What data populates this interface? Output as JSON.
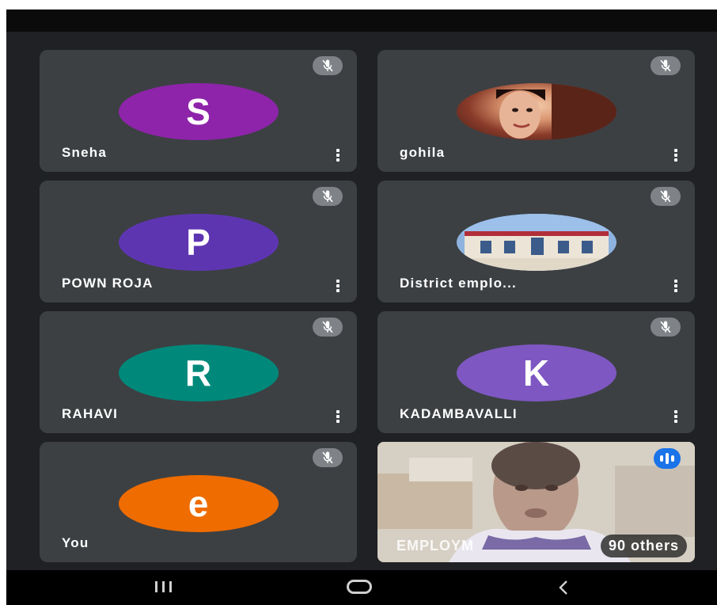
{
  "participants": [
    {
      "name": "Sneha",
      "initial": "S",
      "color": "#8e24aa",
      "photo": false
    },
    {
      "name": "gohila",
      "initial": "",
      "color": "#b0684a",
      "photo": true
    },
    {
      "name": "POWN ROJA",
      "initial": "P",
      "color": "#5e35b1",
      "photo": false
    },
    {
      "name": "District emplo...",
      "initial": "",
      "color": "#9fb8d8",
      "photo": true
    },
    {
      "name": "RAHAVI",
      "initial": "R",
      "color": "#00897b",
      "photo": false
    },
    {
      "name": "KADAMBAVALLI",
      "initial": "K",
      "color": "#7e57c2",
      "photo": false
    },
    {
      "name": "You",
      "initial": "e",
      "color": "#ef6c00",
      "photo": false
    }
  ],
  "featured": {
    "name": "EMPLOYM",
    "others_label": "90 others"
  },
  "icons": {
    "mute": "mic-off-icon",
    "more": "more-vert-icon",
    "audio": "audio-level-icon"
  },
  "navbar": {
    "recents": "recents-icon",
    "home": "home-icon",
    "back": "back-icon"
  }
}
